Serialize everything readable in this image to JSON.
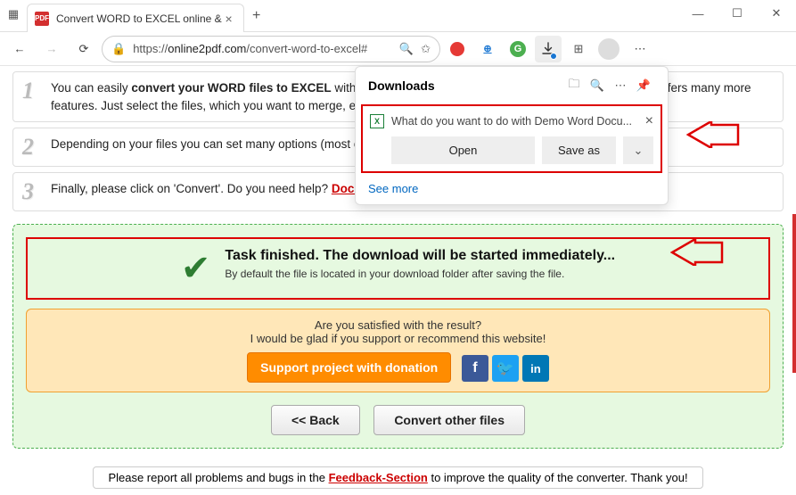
{
  "browser": {
    "tab_title": "Convert WORD to EXCEL online &",
    "favicon_text": "PDF",
    "url_host": "online2pdf.com",
    "url_path": "/convert-word-to-excel#",
    "url_prefix": "https://"
  },
  "downloads": {
    "title": "Downloads",
    "prompt": "What do you want to do with Demo Word Docu...",
    "open": "Open",
    "save_as": "Save as",
    "see_more": "See more"
  },
  "steps": {
    "s1_a": "You can easily ",
    "s1_b": "convert your WORD files to EXCEL",
    "s1_c": " with this online tool. Furthermore, the Online PDF Converter offers many more features. Just select the files, which you want to merge, edit, unlock or convert.",
    "s2": "Depending on your files you can set many options (most of them can be combined!)",
    "s3_a": "Finally, please click on 'Convert'. Do you need help? ",
    "s3_link": "Documentation of all features"
  },
  "task": {
    "title": "Task finished. The download will be started immediately...",
    "sub": "By default the file is located in your download folder after saving the file."
  },
  "support": {
    "q": "Are you satisfied with the result?",
    "line": "I would be glad if you support or recommend this website!",
    "donate": "Support project with donation"
  },
  "buttons": {
    "back": "<< Back",
    "convert_other": "Convert other files"
  },
  "footer": {
    "a": "Please report all problems and bugs in the ",
    "link": "Feedback-Section",
    "b": " to improve the quality of the converter. Thank you!"
  }
}
